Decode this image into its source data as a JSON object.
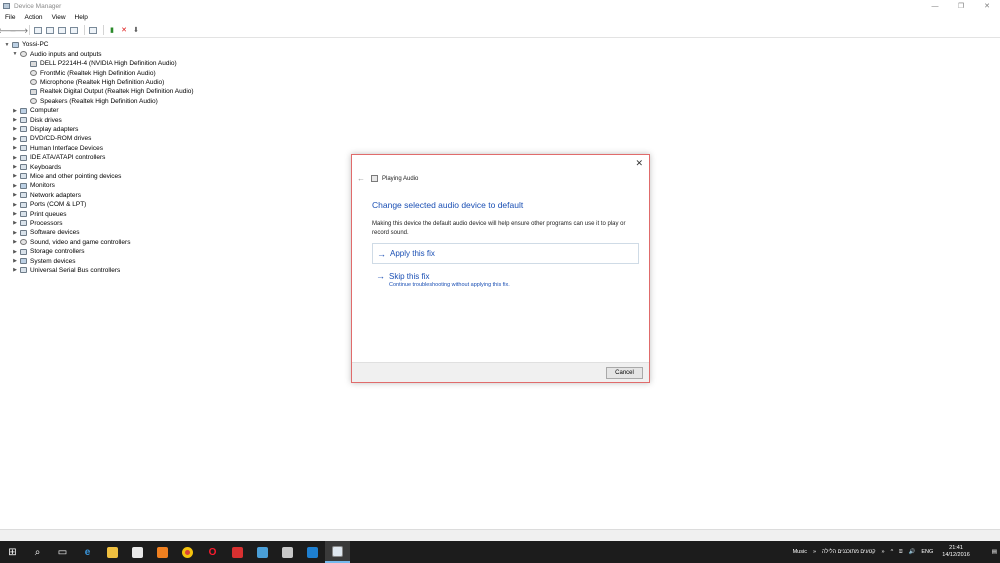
{
  "window": {
    "title": "Device Manager",
    "controls": [
      "—",
      "❐",
      "✕"
    ]
  },
  "menu": [
    "File",
    "Action",
    "View",
    "Help"
  ],
  "tree": {
    "root": "Yossi-PC",
    "audio_group": "Audio inputs and outputs",
    "audio_children": [
      "DELL P2214H-4 (NVIDIA High Definition Audio)",
      "FrontMic (Realtek High Definition Audio)",
      "Microphone (Realtek High Definition Audio)",
      "Realtek Digital Output (Realtek High Definition Audio)",
      "Speakers (Realtek High Definition Audio)"
    ],
    "categories": [
      "Computer",
      "Disk drives",
      "Display adapters",
      "DVD/CD-ROM drives",
      "Human Interface Devices",
      "IDE ATA/ATAPI controllers",
      "Keyboards",
      "Mice and other pointing devices",
      "Monitors",
      "Network adapters",
      "Ports (COM & LPT)",
      "Print queues",
      "Processors",
      "Software devices",
      "Sound, video and game controllers",
      "Storage controllers",
      "System devices",
      "Universal Serial Bus controllers"
    ]
  },
  "dialog": {
    "header_title": "Playing Audio",
    "heading": "Change selected audio device to default",
    "description": "Making this device the default audio device will help ensure other programs can use it to play or record sound.",
    "apply_label": "Apply this fix",
    "skip_label": "Skip this fix",
    "skip_sub": "Continue troubleshooting without applying this fix.",
    "cancel_label": "Cancel"
  },
  "taskbar": {
    "music_label": "Music",
    "hebrew_label": "קטעים מתוכננים הלילה",
    "lang": "ENG",
    "time": "21:41",
    "date": "14/12/2016"
  }
}
